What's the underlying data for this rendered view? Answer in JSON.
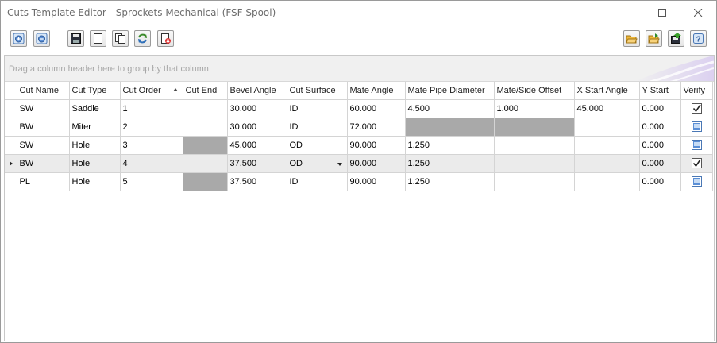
{
  "window": {
    "title": "Cuts Template Editor - Sprockets Mechanical (FSF Spool)"
  },
  "toolbar": {
    "left_buttons": [
      "add-row-icon",
      "remove-row-icon",
      "save-icon",
      "new-document-icon",
      "copy-icon",
      "refresh-icon",
      "delete-icon"
    ],
    "right_buttons": [
      "open-folder-icon",
      "folder-import-icon",
      "export-icon",
      "help-icon"
    ]
  },
  "group_panel": {
    "hint": "Drag a column header here to group by that column"
  },
  "grid": {
    "columns": [
      "Cut Name",
      "Cut Type",
      "Cut Order",
      "Cut End",
      "Bevel Angle",
      "Cut Surface",
      "Mate Angle",
      "Mate Pipe Diameter",
      "Mate/Side Offset",
      "X Start Angle",
      "Y Start",
      "Verify"
    ],
    "sorted_column": "Cut Order",
    "rows": [
      {
        "cut_name": "SW",
        "cut_type": "Saddle",
        "cut_order": "1",
        "cut_end": "",
        "bevel_angle": "30.000",
        "cut_surface": "ID",
        "mate_angle": "60.000",
        "mate_pipe_diameter": "4.500",
        "mate_side_offset": "1.000",
        "x_start_angle": "45.000",
        "y_start": "0.000",
        "verify": true
      },
      {
        "cut_name": "BW",
        "cut_type": "Miter",
        "cut_order": "2",
        "cut_end": "",
        "bevel_angle": "30.000",
        "cut_surface": "ID",
        "mate_angle": "72.000",
        "mate_pipe_diameter": "",
        "mate_side_offset": "",
        "x_start_angle": "",
        "y_start": "0.000",
        "verify": false
      },
      {
        "cut_name": "SW",
        "cut_type": "Hole",
        "cut_order": "3",
        "cut_end": "",
        "bevel_angle": "45.000",
        "cut_surface": "OD",
        "mate_angle": "90.000",
        "mate_pipe_diameter": "1.250",
        "mate_side_offset": "",
        "x_start_angle": "",
        "y_start": "0.000",
        "verify": false
      },
      {
        "cut_name": "BW",
        "cut_type": "Hole",
        "cut_order": "4",
        "cut_end": "",
        "bevel_angle": "37.500",
        "cut_surface": "OD",
        "mate_angle": "90.000",
        "mate_pipe_diameter": "1.250",
        "mate_side_offset": "",
        "x_start_angle": "",
        "y_start": "0.000",
        "verify": true
      },
      {
        "cut_name": "PL",
        "cut_type": "Hole",
        "cut_order": "5",
        "cut_end": "",
        "bevel_angle": "37.500",
        "cut_surface": "ID",
        "mate_angle": "90.000",
        "mate_pipe_diameter": "1.250",
        "mate_side_offset": "",
        "x_start_angle": "",
        "y_start": "0.000",
        "verify": false
      }
    ],
    "focused_row": 3
  },
  "colors": {
    "disabled_cell": "#a9a9a9",
    "focused_row": "#ebebeb",
    "group_panel": "#f0f0f0"
  }
}
